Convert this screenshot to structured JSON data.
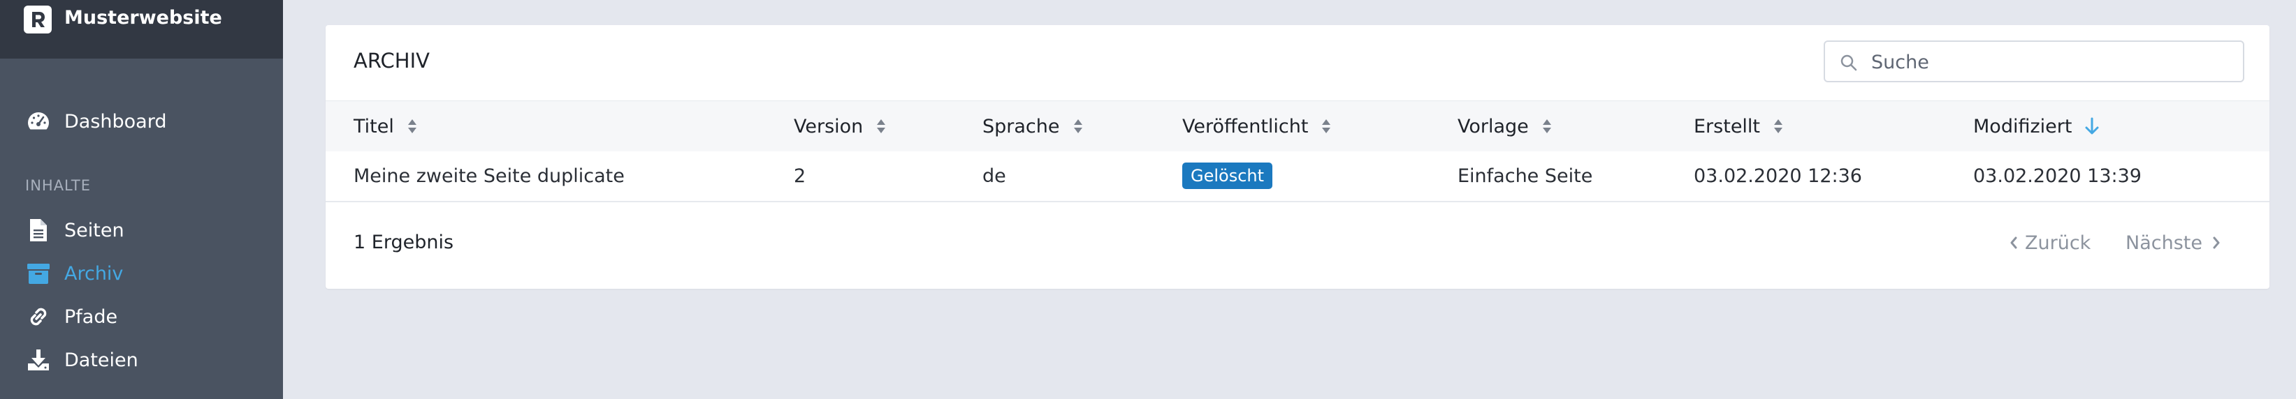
{
  "brand": {
    "name": "Musterwebsite",
    "logo_letter": "R"
  },
  "sidebar": {
    "dashboard": "Dashboard",
    "section": "INHALTE",
    "items": [
      {
        "label": "Seiten",
        "icon": "file-icon"
      },
      {
        "label": "Archiv",
        "icon": "archive-icon",
        "active": true
      },
      {
        "label": "Pfade",
        "icon": "link-icon"
      },
      {
        "label": "Dateien",
        "icon": "download-icon"
      }
    ]
  },
  "card": {
    "title": "ARCHIV",
    "search_placeholder": "Suche"
  },
  "table": {
    "columns": [
      "Titel",
      "Version",
      "Sprache",
      "Veröffentlicht",
      "Vorlage",
      "Erstellt",
      "Modifiziert"
    ],
    "sorted_column": "Modifiziert",
    "rows": [
      {
        "title": "Meine zweite Seite duplicate",
        "version": "2",
        "language": "de",
        "published": "Gelöscht",
        "template": "Einfache Seite",
        "created": "03.02.2020 12:36",
        "modified": "03.02.2020 13:39"
      }
    ]
  },
  "footer": {
    "count": "1 Ergebnis",
    "prev": "Zurück",
    "next": "Nächste"
  },
  "colors": {
    "accent": "#44a8e3",
    "badge": "#1b79bf",
    "sidebar": "#4a5361",
    "brand_bar": "#323843"
  }
}
